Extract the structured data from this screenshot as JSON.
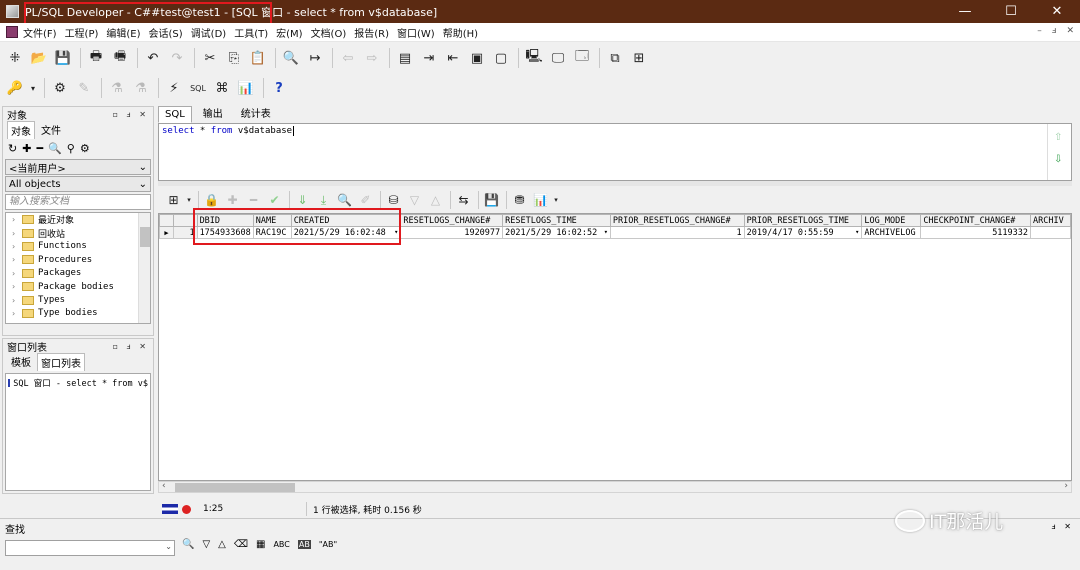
{
  "window": {
    "title": "PL/SQL Developer - C##test@test1 - [SQL 窗口 - select * from v$database]",
    "controls": [
      "—",
      "☐",
      "✕"
    ]
  },
  "menu": {
    "items": [
      "文件(F)",
      "工程(P)",
      "编辑(E)",
      "会话(S)",
      "调试(D)",
      "工具(T)",
      "宏(M)",
      "文档(O)",
      "报告(R)",
      "窗口(W)",
      "帮助(H)"
    ],
    "mdi_controls": [
      "–",
      "ⅎ",
      "✕"
    ]
  },
  "toolbar1": {
    "icons": [
      "new-icon",
      "open-icon",
      "save-icon",
      "print-icon",
      "print-preview-icon",
      "undo-icon",
      "redo-icon",
      "cut-icon",
      "copy-icon",
      "paste-icon",
      "find-icon",
      "find-next-icon",
      "back-icon",
      "forward-icon",
      "explain-icon",
      "indent-icon",
      "unindent-icon",
      "comment-icon",
      "uncomment-icon",
      "connect-icon",
      "session-icon",
      "query-builder-icon",
      "window-list-icon",
      "tile-icon"
    ]
  },
  "toolbar2": {
    "icons": [
      "key-icon",
      "compile-icon",
      "pencil-icon",
      "flask-icon",
      "flask-icon-2",
      "execute-icon",
      "sql-icon",
      "command-icon",
      "report-icon",
      "help-icon"
    ]
  },
  "object_panel": {
    "title": "对象",
    "header_buttons": "▫ ⅎ ✕",
    "tabs": [
      "对象",
      "文件"
    ],
    "tools": [
      "↻",
      "✚",
      "━",
      "🔍",
      "⚲",
      "⚙"
    ],
    "user_combo": "<当前用户>",
    "type_combo": "All objects",
    "filter_placeholder": "输入搜索文档",
    "tree": [
      "最近对象",
      "回收站",
      "Functions",
      "Procedures",
      "Packages",
      "Package bodies",
      "Types",
      "Type bodies"
    ]
  },
  "window_list_panel": {
    "title": "窗口列表",
    "header_buttons": "▫ ⅎ ✕",
    "tabs": [
      "模板",
      "窗口列表"
    ],
    "items": [
      "SQL 窗口 - select * from v$"
    ]
  },
  "editor": {
    "tabs": [
      "SQL",
      "输出",
      "统计表"
    ],
    "sql_kw1": "select",
    "sql_mid": " * ",
    "sql_kw2": "from",
    "sql_tail": " v$database"
  },
  "grid_toolbar": {
    "icons": [
      "grid-icon",
      "lock-icon",
      "plus-icon",
      "minus-icon",
      "check-icon",
      "down-icon",
      "down2-icon",
      "find-icon",
      "clear-icon",
      "query-icon",
      "prev-icon",
      "next-icon",
      "export-icon",
      "save-icon",
      "chart-icon",
      "report-icon"
    ]
  },
  "result_grid": {
    "columns": [
      "DBID",
      "NAME",
      "CREATED",
      "RESETLOGS_CHANGE#",
      "RESETLOGS_TIME",
      "PRIOR_RESETLOGS_CHANGE#",
      "PRIOR_RESETLOGS_TIME",
      "LOG_MODE",
      "CHECKPOINT_CHANGE#",
      "ARCHIV"
    ],
    "rows": [
      {
        "rownum": "1",
        "cells": [
          "1754933608",
          "RAC19C",
          "2021/5/29 16:02:48",
          "1920977",
          "2021/5/29 16:02:52",
          "1",
          "2019/4/17 0:55:59",
          "ARCHIVELOG",
          "5119332",
          ""
        ]
      }
    ]
  },
  "status": {
    "position": "1:25",
    "message": "1 行被选择, 耗时 0.156 秒"
  },
  "find_bar": {
    "title": "查找",
    "header_buttons": "ⅎ ✕",
    "tools": [
      "🔍",
      "▽",
      "△",
      "⌫",
      "▦",
      "ABC",
      "AB",
      "\"AB\""
    ]
  },
  "watermark": {
    "text": "IT那活儿"
  }
}
